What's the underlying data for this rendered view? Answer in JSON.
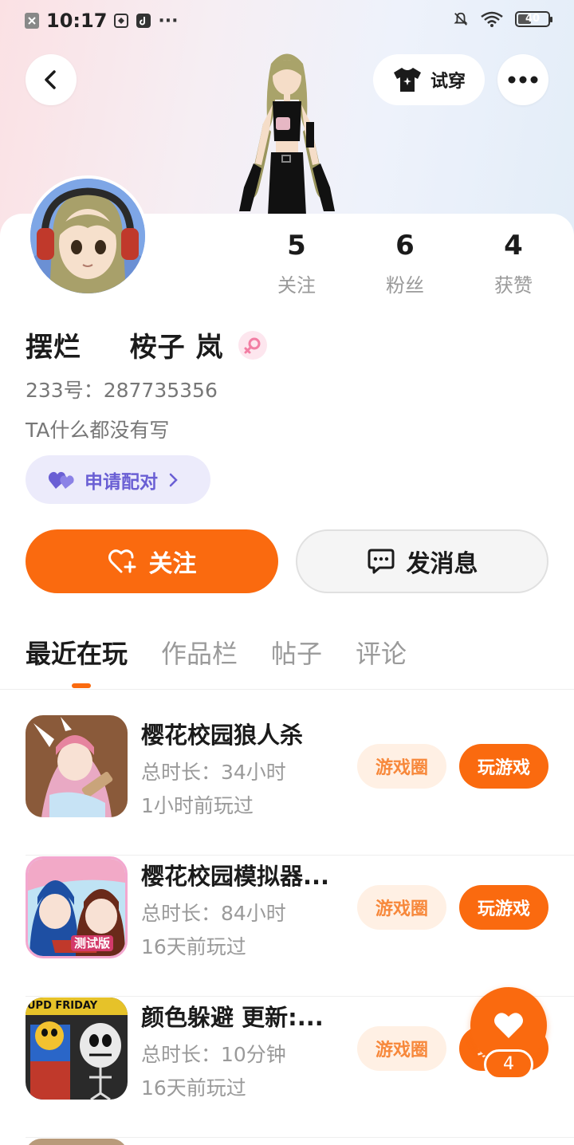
{
  "status_bar": {
    "time": "10:17",
    "dots": "···",
    "battery": "40"
  },
  "header": {
    "tryon_label": "试穿"
  },
  "stats": [
    {
      "value": "5",
      "label": "关注"
    },
    {
      "value": "6",
      "label": "粉丝"
    },
    {
      "value": "4",
      "label": "获赞"
    }
  ],
  "profile": {
    "name": "摆烂   ​桉子 岚",
    "uid": "233号：287735356",
    "bio": "TA什么都没有写",
    "pair_label": "申请配对"
  },
  "actions": {
    "follow_label": "关注",
    "message_label": "发消息"
  },
  "tabs": [
    "最近在玩",
    "作品栏",
    "帖子",
    "评论"
  ],
  "games": [
    {
      "title": "樱花校园狼人杀",
      "time": "总时长：34小时",
      "last": "1小时前玩过",
      "circle": "游戏圈",
      "play": "玩游戏"
    },
    {
      "title": "樱花校园模拟器...",
      "time": "总时长：84小时",
      "last": "16天前玩过",
      "circle": "游戏圈",
      "play": "玩游戏"
    },
    {
      "title": "颜色躲避 更新:...",
      "time": "总时长：10分钟",
      "last": "16天前玩过",
      "circle": "游戏圈",
      "play": "玩游戏"
    }
  ],
  "fab": {
    "count": "4"
  },
  "thumb_texts": {
    "g2_badge": "测试版",
    "g3_badge": "UPD FRIDAY"
  },
  "colors": {
    "accent": "#fa6a0f",
    "pair": "#6a5fd4",
    "muted": "#9a9a9a"
  }
}
